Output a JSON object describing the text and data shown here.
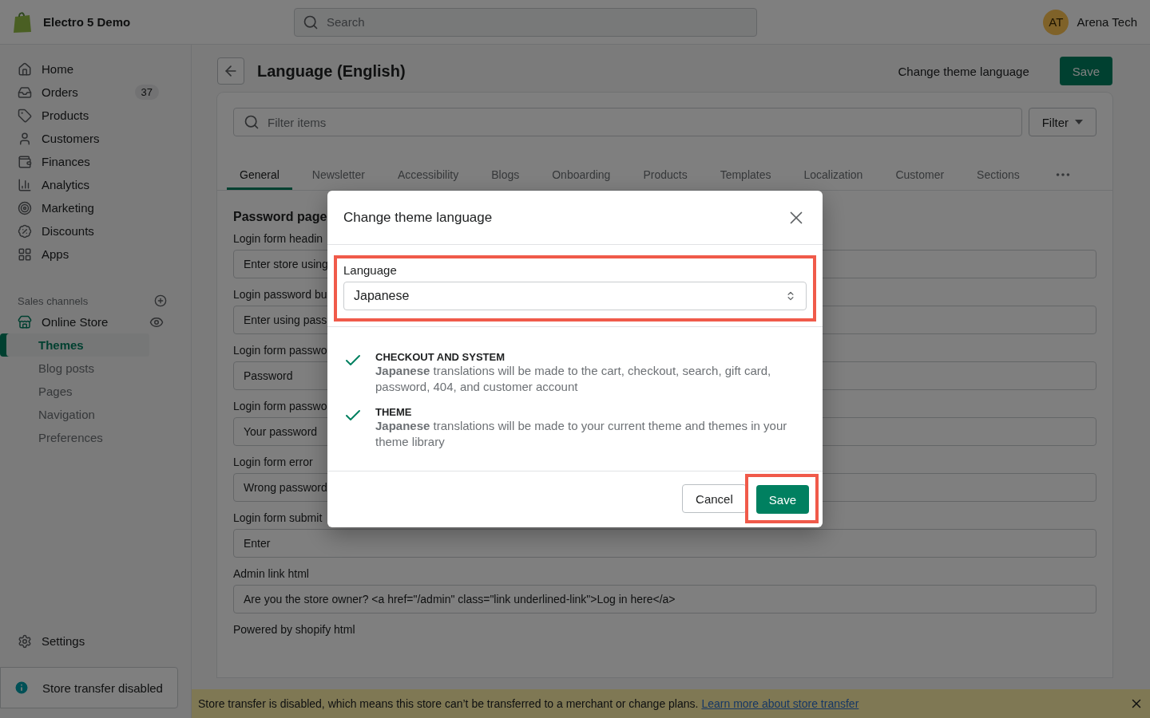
{
  "topbar": {
    "store_name": "Electro 5 Demo",
    "search": {
      "placeholder": "Search"
    },
    "user": {
      "initials": "AT",
      "name": "Arena Tech"
    }
  },
  "sidebar": {
    "items": [
      {
        "label": "Home"
      },
      {
        "label": "Orders",
        "count": "37"
      },
      {
        "label": "Products"
      },
      {
        "label": "Customers"
      },
      {
        "label": "Finances"
      },
      {
        "label": "Analytics"
      },
      {
        "label": "Marketing"
      },
      {
        "label": "Discounts"
      },
      {
        "label": "Apps"
      }
    ],
    "sales_channels": {
      "heading": "Sales channels",
      "channel": "Online Store",
      "subitems": [
        {
          "label": "Themes",
          "selected": true
        },
        {
          "label": "Blog posts",
          "selected": false
        },
        {
          "label": "Pages",
          "selected": false
        },
        {
          "label": "Navigation",
          "selected": false
        },
        {
          "label": "Preferences",
          "selected": false
        }
      ]
    },
    "settings": "Settings",
    "notice": "Store transfer disabled"
  },
  "page": {
    "title": "Language (English)",
    "change_language": "Change theme language",
    "save": "Save",
    "filter": {
      "placeholder": "Filter items",
      "button": "Filter"
    },
    "tabs": [
      {
        "label": "General",
        "selected": true
      },
      {
        "label": "Newsletter",
        "selected": false
      },
      {
        "label": "Accessibility",
        "selected": false
      },
      {
        "label": "Blogs",
        "selected": false
      },
      {
        "label": "Onboarding",
        "selected": false
      },
      {
        "label": "Products",
        "selected": false
      },
      {
        "label": "Templates",
        "selected": false
      },
      {
        "label": "Localization",
        "selected": false
      },
      {
        "label": "Customer",
        "selected": false
      },
      {
        "label": "Sections",
        "selected": false
      }
    ],
    "section_title": "Password page",
    "fields": [
      {
        "label": "Login form headin",
        "value": "Enter store using"
      },
      {
        "label": "Login password bu",
        "value": "Enter using pass"
      },
      {
        "label": "Login form passwo",
        "value": "Password"
      },
      {
        "label": "Login form passwo",
        "value": "Your password"
      },
      {
        "label": "Login form error",
        "value": "Wrong password"
      },
      {
        "label": "Login form submit",
        "value": "Enter"
      },
      {
        "label": "Admin link html",
        "value": "Are you the store owner? <a href=\"/admin\" class=\"link underlined-link\">Log in here</a>"
      },
      {
        "label": "Powered by shopify html"
      }
    ]
  },
  "banner": {
    "text": "Store transfer is disabled, which means this store can’t be transferred to a merchant or change plans.",
    "link": "Learn more about store transfer"
  },
  "modal": {
    "title": "Change theme language",
    "field_label": "Language",
    "value": "Japanese",
    "items": [
      {
        "heading": "CHECKOUT AND SYSTEM",
        "text": "**Japanese** translations will be made to the cart, checkout, search, gift card, password, 404, and customer account"
      },
      {
        "heading": "THEME",
        "text": "**Japanese** translations will be made to your current theme and themes in your theme library"
      }
    ],
    "cancel": "Cancel",
    "save": "Save"
  }
}
